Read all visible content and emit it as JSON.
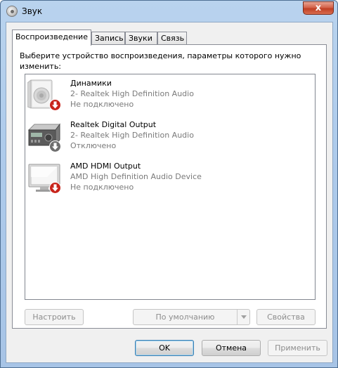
{
  "window": {
    "title": "Звук",
    "close_glyph": "x"
  },
  "tabs": [
    {
      "label": "Воспроизведение",
      "active": true
    },
    {
      "label": "Запись",
      "active": false
    },
    {
      "label": "Звуки",
      "active": false
    },
    {
      "label": "Связь",
      "active": false
    }
  ],
  "panel": {
    "instruction": "Выберите устройство воспроизведения, параметры которого нужно изменить:"
  },
  "devices": [
    {
      "name": "Динамики",
      "driver": "2- Realtek High Definition Audio",
      "status": "Не подключено",
      "icon": "speaker-icon",
      "badge": "red-down-arrow"
    },
    {
      "name": "Realtek Digital Output",
      "driver": "2- Realtek High Definition Audio",
      "status": "Отключено",
      "icon": "receiver-icon",
      "badge": "gray-down-arrow"
    },
    {
      "name": "AMD HDMI Output",
      "driver": "AMD High Definition Audio Device",
      "status": "Не подключено",
      "icon": "monitor-icon",
      "badge": "red-down-arrow"
    }
  ],
  "panel_buttons": {
    "configure": "Настроить",
    "set_default": "По умолчанию",
    "properties": "Свойства"
  },
  "dialog_buttons": {
    "ok": "OK",
    "cancel": "Отмена",
    "apply": "Применить"
  },
  "colors": {
    "badge_red": "#c8241b",
    "badge_gray": "#6e6e6e",
    "title_gradient": "#aecbeb",
    "close_red": "#c03f24"
  }
}
